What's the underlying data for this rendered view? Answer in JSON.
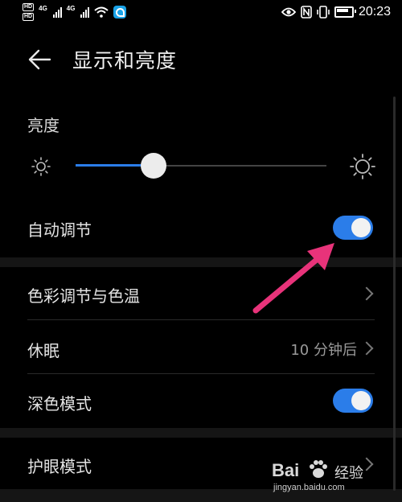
{
  "status_bar": {
    "hd_1": "HD",
    "hd_2": "HD",
    "net_1": "4G",
    "net_2": "4G",
    "time": "20:23"
  },
  "header": {
    "title": "显示和亮度"
  },
  "brightness": {
    "label": "亮度",
    "level_percent": 31
  },
  "rows": {
    "auto_adjust": {
      "label": "自动调节",
      "on": true
    },
    "color_temp": {
      "label": "色彩调节与色温"
    },
    "sleep": {
      "label": "休眠",
      "value": "10 分钟后"
    },
    "dark_mode": {
      "label": "深色模式",
      "on": true
    },
    "eye_comfort": {
      "label": "护眼模式"
    }
  },
  "watermark": {
    "logo_text": "Bai",
    "suffix": "经验",
    "url": "jingyan.baidu.com"
  },
  "colors": {
    "accent": "#2b7de9",
    "annotation_arrow": "#e8337a",
    "background": "#000000"
  }
}
